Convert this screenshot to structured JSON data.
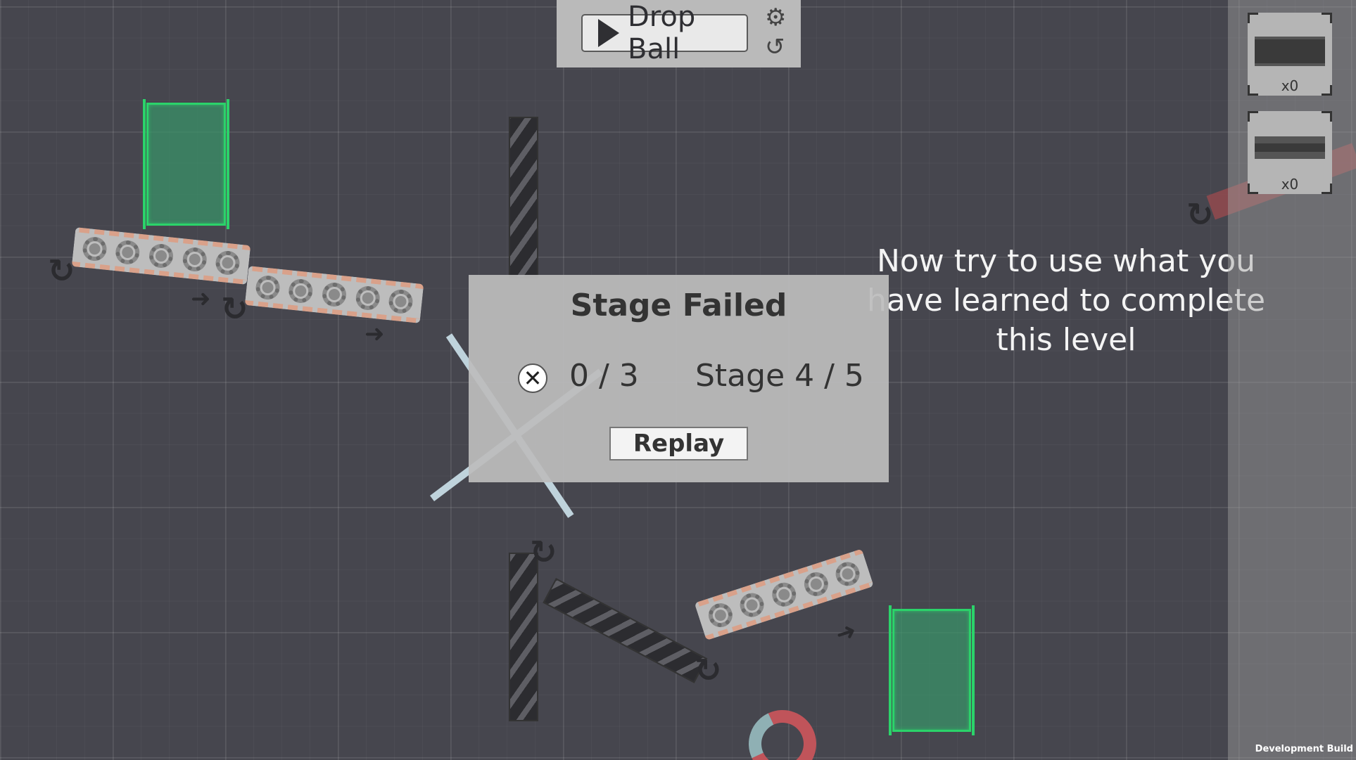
{
  "toolbar": {
    "drop_ball_label": "Drop Ball",
    "settings_icon": "gear-icon",
    "restart_icon": "restart-icon"
  },
  "inventory": {
    "items": [
      {
        "name": "conveyor-part",
        "count": "x0"
      },
      {
        "name": "plank-part",
        "count": "x0"
      }
    ]
  },
  "hint": {
    "line1": "Now try to use what you",
    "line2": "have learned to complete",
    "line3": "this level"
  },
  "dialog": {
    "title": "Stage Failed",
    "score": "0 / 3",
    "stage": "Stage 4 / 5",
    "replay_label": "Replay"
  },
  "footer": {
    "build": "Development Build"
  },
  "colors": {
    "background": "#46464e",
    "bin_green": "#2bd36a",
    "conveyor_stripe": "#d9a18a"
  }
}
